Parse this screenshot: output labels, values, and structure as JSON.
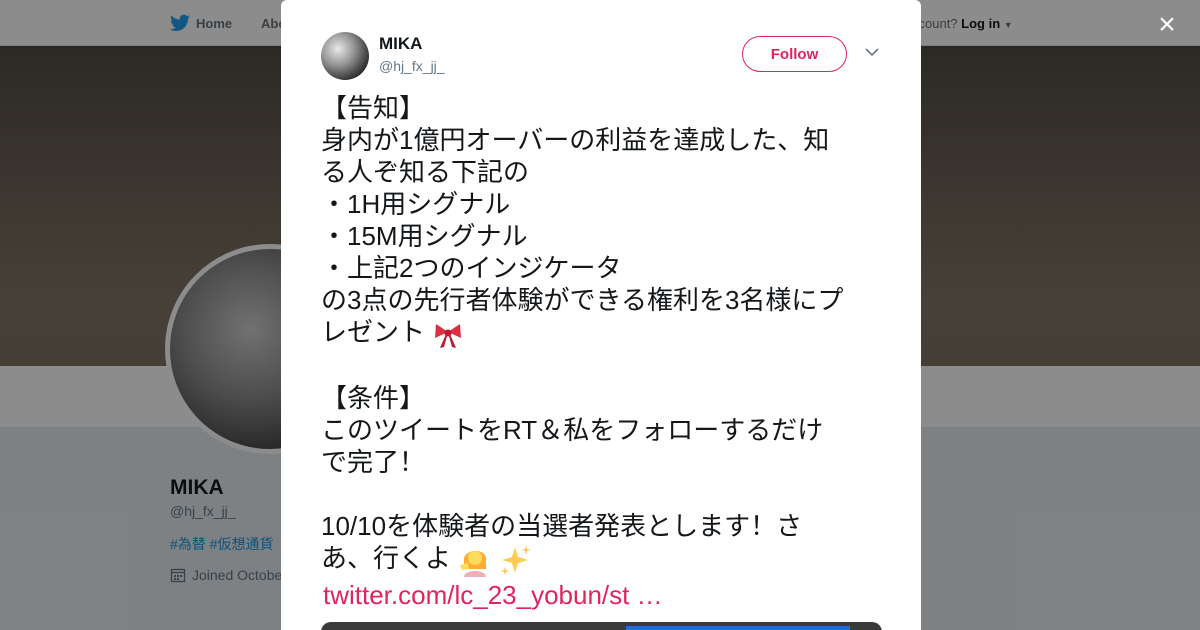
{
  "background": {
    "nav": {
      "home": "Home",
      "about": "Abo",
      "account_prompt": "ccount?",
      "login": "Log in"
    },
    "profile": {
      "name": "MIKA",
      "handle": "@hj_fx_jj_",
      "bio_tags": "#為替 #仮想通貨",
      "joined": "Joined Octobe"
    }
  },
  "modal": {
    "close_label": "×",
    "author": {
      "name": "MIKA",
      "handle": "@hj_fx_jj_"
    },
    "follow_label": "Follow",
    "tweet_lines": [
      "【告知】",
      "身内が1億円オーバーの利益を達成した、知",
      "る人ぞ知る下記の",
      "・1H用シグナル",
      "・15M用シグナル",
      "・上記2つのインジケータ",
      "の3点の先行者体験ができる権利を3名様にプ",
      "レゼント",
      "",
      "【条件】",
      "このツイートをRT＆私をフォローするだけ",
      "で完了！",
      "",
      "10/10を体験者の当選者発表とします！さ",
      "あ、行くよ"
    ],
    "link": "twitter.com/lc_23_yobun/st …"
  },
  "colors": {
    "accent": "#e0245e",
    "twitter_blue": "#1da1f2"
  }
}
